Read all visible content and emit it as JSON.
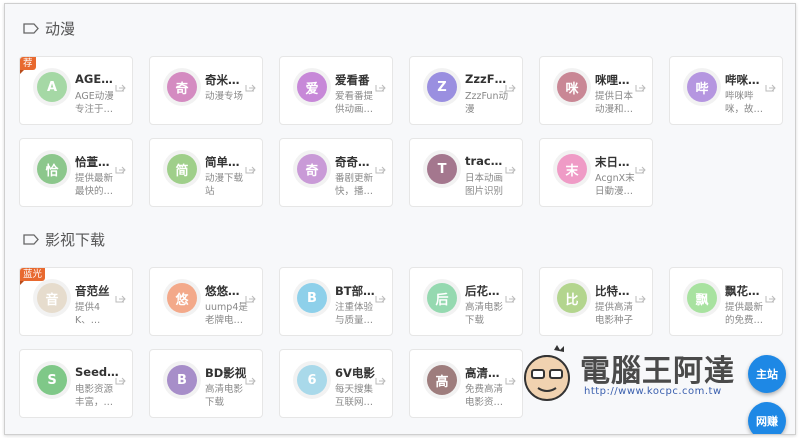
{
  "sections": [
    {
      "title": "动漫",
      "icon": "tag-icon"
    },
    {
      "title": "影视下载",
      "icon": "tag-icon"
    }
  ],
  "anime": [
    {
      "avatar": "A",
      "color": "#a5d8a5",
      "title": "AGE…",
      "desc": "AGE动漫专注于…",
      "badge": "荐"
    },
    {
      "avatar": "奇",
      "color": "#d48bc1",
      "title": "奇米…",
      "desc": "动漫专场"
    },
    {
      "avatar": "爱",
      "color": "#c788d8",
      "title": "爱看番",
      "desc": "爱看番提供动画…"
    },
    {
      "avatar": "Z",
      "color": "#9a8fe0",
      "title": "ZzzF…",
      "desc": "ZzzFun动漫"
    },
    {
      "avatar": "咪",
      "color": "#c98795",
      "title": "咪哩…",
      "desc": "提供日本动漫和…"
    },
    {
      "avatar": "哔",
      "color": "#b596e0",
      "title": "哔咪…",
      "desc": "哔咪哔咪，故…"
    },
    {
      "avatar": "恰",
      "color": "#8cc78c",
      "title": "恰萱…",
      "desc": "提供最新最快的…"
    },
    {
      "avatar": "简",
      "color": "#9fcf8a",
      "title": "简单…",
      "desc": "动漫下载站"
    },
    {
      "avatar": "奇",
      "color": "#c99ad7",
      "title": "奇奇…",
      "desc": "番剧更新快，播…"
    },
    {
      "avatar": "T",
      "color": "#a4778e",
      "title": "trace…",
      "desc": "日本动画图片识别"
    },
    {
      "avatar": "末",
      "color": "#ef9bc6",
      "title": "末日…",
      "desc": "AcgnX末日動漫…"
    }
  ],
  "movies": [
    {
      "avatar": "音",
      "color": "#e6dccd",
      "title": "音范丝",
      "desc": "提供4K、…",
      "badge": "蓝光"
    },
    {
      "avatar": "悠",
      "color": "#f3a98a",
      "title": "悠悠…",
      "desc": "uump4是老牌电…"
    },
    {
      "avatar": "B",
      "color": "#8ed0ea",
      "title": "BT部…",
      "desc": "注重体验与质量…"
    },
    {
      "avatar": "后",
      "color": "#95d9b0",
      "title": "后花…",
      "desc": "高清电影下载"
    },
    {
      "avatar": "比",
      "color": "#b3d58e",
      "title": "比特…",
      "desc": "提供高清电影种子"
    },
    {
      "avatar": "飘",
      "color": "#a8e2a0",
      "title": "飘花…",
      "desc": "提供最新的免费…"
    },
    {
      "avatar": "S",
      "color": "#7fc888",
      "title": "Seed…",
      "desc": "电影资源丰富，…"
    },
    {
      "avatar": "B",
      "color": "#a78ec9",
      "title": "BD影视",
      "desc": "高清电影下载"
    },
    {
      "avatar": "6",
      "color": "#a9d9ea",
      "title": "6V电影",
      "desc": "每天搜集互联网…"
    },
    {
      "avatar": "高",
      "color": "#9e7d7d",
      "title": "高清…",
      "desc": "免费高清电影资…"
    }
  ],
  "watermark": {
    "text": "電腦王阿達",
    "url": "http://www.kocpc.com.tw"
  },
  "fabs": [
    "主站",
    "网赚"
  ]
}
